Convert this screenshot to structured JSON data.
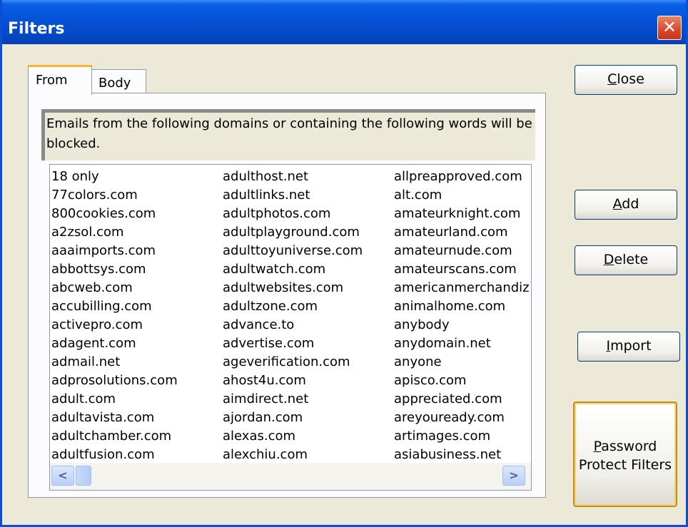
{
  "window": {
    "title": "Filters"
  },
  "tabs": [
    {
      "label": "From",
      "active": true
    },
    {
      "label": "Body",
      "active": false
    }
  ],
  "description": "Emails from the following domains or containing the following words will be blocked.",
  "list": {
    "column_1": [
      "18 only",
      "77colors.com",
      "800cookies.com",
      "a2zsol.com",
      "aaaimports.com",
      "abbottsys.com",
      "abcweb.com",
      "accubilling.com",
      "activepro.com",
      "adagent.com",
      "admail.net",
      "adprosolutions.com",
      "adult.com",
      "adultavista.com",
      "adultchamber.com",
      "adultfusion.com"
    ],
    "column_2": [
      "adulthost.net",
      "adultlinks.net",
      "adultphotos.com",
      "adultplayground.com",
      "adulttoyuniverse.com",
      "adultwatch.com",
      "adultwebsites.com",
      "adultzone.com",
      "advance.to",
      "advertise.com",
      "ageverification.com",
      "ahost4u.com",
      "aimdirect.net",
      "ajordan.com",
      "alexas.com",
      "alexchiu.com"
    ],
    "column_3": [
      "allpreapproved.com",
      "alt.com",
      "amateurknight.com",
      "amateurland.com",
      "amateurnude.com",
      "amateurscans.com",
      "americanmerchandiz",
      "animalhome.com",
      "anybody",
      "anydomain.net",
      "anyone",
      "apisco.com",
      "appreciated.com",
      "areyouready.com",
      "artimages.com",
      "asiabusiness.net"
    ]
  },
  "scrollbar": {
    "left_arrow": "<",
    "right_arrow": ">"
  },
  "buttons": {
    "close": {
      "accel": "C",
      "rest": "lose"
    },
    "add": {
      "accel": "A",
      "rest": "dd"
    },
    "delete": {
      "accel": "D",
      "rest": "elete"
    },
    "import": {
      "accel": "I",
      "rest": "mport"
    },
    "password": {
      "accel": "P",
      "rest_line1": "assword",
      "line2": "Protect Filters"
    }
  },
  "title_close_glyph": "✕"
}
